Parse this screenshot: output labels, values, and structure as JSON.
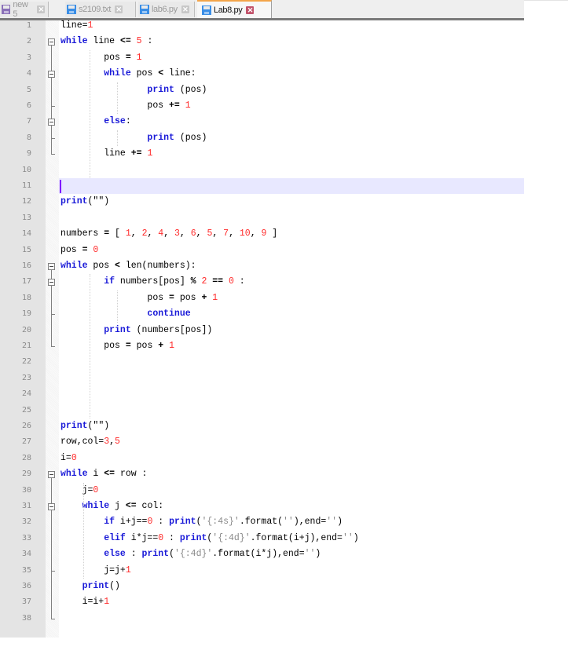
{
  "tabs": [
    {
      "label": "new 5",
      "icon": "floppy-disk-icon",
      "icon_color": "#8a70b8",
      "active": false
    },
    {
      "label": "s2109.txt",
      "icon": "floppy-disk-icon",
      "icon_color": "#3a8ee6",
      "active": false
    },
    {
      "label": "lab6.py",
      "icon": "floppy-disk-icon",
      "icon_color": "#3a8ee6",
      "active": false
    },
    {
      "label": "Lab8.py",
      "icon": "floppy-disk-icon",
      "icon_color": "#3a8ee6",
      "active": true
    }
  ],
  "close_glyph": "✕",
  "colors": {
    "keyword": "#1a1ad8",
    "number": "#ff2a2a",
    "string": "#8a8a8a",
    "caret_line": "#e8e8ff",
    "active_tab_accent": "#f3a54a"
  },
  "editor": {
    "current_line": 11,
    "lines": [
      {
        "n": "1",
        "tokens": [
          [
            "t",
            "line="
          ],
          [
            "n",
            "1"
          ]
        ]
      },
      {
        "n": "2",
        "tokens": [
          [
            "k",
            "while"
          ],
          [
            "t",
            " line "
          ],
          [
            "o",
            "<="
          ],
          [
            "t",
            " "
          ],
          [
            "n",
            "5"
          ],
          [
            "t",
            " :"
          ]
        ]
      },
      {
        "n": "3",
        "tokens": [
          [
            "t",
            "        pos "
          ],
          [
            "o",
            "="
          ],
          [
            "t",
            " "
          ],
          [
            "n",
            "1"
          ]
        ]
      },
      {
        "n": "4",
        "tokens": [
          [
            "t",
            "        "
          ],
          [
            "k",
            "while"
          ],
          [
            "t",
            " pos "
          ],
          [
            "o",
            "<"
          ],
          [
            "t",
            " line:"
          ]
        ]
      },
      {
        "n": "5",
        "tokens": [
          [
            "t",
            "                "
          ],
          [
            "k",
            "print"
          ],
          [
            "t",
            " (pos)"
          ]
        ]
      },
      {
        "n": "6",
        "tokens": [
          [
            "t",
            "                pos "
          ],
          [
            "o",
            "+="
          ],
          [
            "t",
            " "
          ],
          [
            "n",
            "1"
          ]
        ]
      },
      {
        "n": "7",
        "tokens": [
          [
            "t",
            "        "
          ],
          [
            "k",
            "else"
          ],
          [
            "t",
            ":"
          ]
        ]
      },
      {
        "n": "8",
        "tokens": [
          [
            "t",
            "                "
          ],
          [
            "k",
            "print"
          ],
          [
            "t",
            " (pos)"
          ]
        ]
      },
      {
        "n": "9",
        "tokens": [
          [
            "t",
            "        line "
          ],
          [
            "o",
            "+="
          ],
          [
            "t",
            " "
          ],
          [
            "n",
            "1"
          ]
        ]
      },
      {
        "n": "10",
        "tokens": []
      },
      {
        "n": "11",
        "tokens": []
      },
      {
        "n": "12",
        "tokens": [
          [
            "k",
            "print"
          ],
          [
            "t",
            "(\"\")"
          ]
        ]
      },
      {
        "n": "13",
        "tokens": []
      },
      {
        "n": "14",
        "tokens": [
          [
            "t",
            "numbers "
          ],
          [
            "o",
            "="
          ],
          [
            "t",
            " [ "
          ],
          [
            "n",
            "1"
          ],
          [
            "t",
            ", "
          ],
          [
            "n",
            "2"
          ],
          [
            "t",
            ", "
          ],
          [
            "n",
            "4"
          ],
          [
            "t",
            ", "
          ],
          [
            "n",
            "3"
          ],
          [
            "t",
            ", "
          ],
          [
            "n",
            "6"
          ],
          [
            "t",
            ", "
          ],
          [
            "n",
            "5"
          ],
          [
            "t",
            ", "
          ],
          [
            "n",
            "7"
          ],
          [
            "t",
            ", "
          ],
          [
            "n",
            "10"
          ],
          [
            "t",
            ", "
          ],
          [
            "n",
            "9"
          ],
          [
            "t",
            " ]"
          ]
        ]
      },
      {
        "n": "15",
        "tokens": [
          [
            "t",
            "pos "
          ],
          [
            "o",
            "="
          ],
          [
            "t",
            " "
          ],
          [
            "n",
            "0"
          ]
        ]
      },
      {
        "n": "16",
        "tokens": [
          [
            "k",
            "while"
          ],
          [
            "t",
            " pos "
          ],
          [
            "o",
            "<"
          ],
          [
            "t",
            " len(numbers):"
          ]
        ]
      },
      {
        "n": "17",
        "tokens": [
          [
            "t",
            "        "
          ],
          [
            "k",
            "if"
          ],
          [
            "t",
            " numbers[pos] "
          ],
          [
            "o",
            "%"
          ],
          [
            "t",
            " "
          ],
          [
            "n",
            "2"
          ],
          [
            "t",
            " "
          ],
          [
            "o",
            "=="
          ],
          [
            "t",
            " "
          ],
          [
            "n",
            "0"
          ],
          [
            "t",
            " :"
          ]
        ]
      },
      {
        "n": "18",
        "tokens": [
          [
            "t",
            "                pos "
          ],
          [
            "o",
            "="
          ],
          [
            "t",
            " pos "
          ],
          [
            "o",
            "+"
          ],
          [
            "t",
            " "
          ],
          [
            "n",
            "1"
          ]
        ]
      },
      {
        "n": "19",
        "tokens": [
          [
            "t",
            "                "
          ],
          [
            "k",
            "continue"
          ]
        ]
      },
      {
        "n": "20",
        "tokens": [
          [
            "t",
            "        "
          ],
          [
            "k",
            "print"
          ],
          [
            "t",
            " (numbers[pos])"
          ]
        ]
      },
      {
        "n": "21",
        "tokens": [
          [
            "t",
            "        pos "
          ],
          [
            "o",
            "="
          ],
          [
            "t",
            " pos "
          ],
          [
            "o",
            "+"
          ],
          [
            "t",
            " "
          ],
          [
            "n",
            "1"
          ]
        ]
      },
      {
        "n": "22",
        "tokens": []
      },
      {
        "n": "23",
        "tokens": []
      },
      {
        "n": "24",
        "tokens": []
      },
      {
        "n": "25",
        "tokens": []
      },
      {
        "n": "26",
        "tokens": [
          [
            "k",
            "print"
          ],
          [
            "t",
            "(\"\")"
          ]
        ]
      },
      {
        "n": "27",
        "tokens": [
          [
            "t",
            "row,col="
          ],
          [
            "n",
            "3"
          ],
          [
            "t",
            ","
          ],
          [
            "n",
            "5"
          ]
        ]
      },
      {
        "n": "28",
        "tokens": [
          [
            "t",
            "i="
          ],
          [
            "n",
            "0"
          ]
        ]
      },
      {
        "n": "29",
        "tokens": [
          [
            "k",
            "while"
          ],
          [
            "t",
            " i "
          ],
          [
            "o",
            "<="
          ],
          [
            "t",
            " row :"
          ]
        ]
      },
      {
        "n": "30",
        "tokens": [
          [
            "t",
            "    j="
          ],
          [
            "n",
            "0"
          ]
        ]
      },
      {
        "n": "31",
        "tokens": [
          [
            "t",
            "    "
          ],
          [
            "k",
            "while"
          ],
          [
            "t",
            " j "
          ],
          [
            "o",
            "<="
          ],
          [
            "t",
            " col:"
          ]
        ]
      },
      {
        "n": "32",
        "tokens": [
          [
            "t",
            "        "
          ],
          [
            "k",
            "if"
          ],
          [
            "t",
            " i+j=="
          ],
          [
            "n",
            "0"
          ],
          [
            "t",
            " : "
          ],
          [
            "k",
            "print"
          ],
          [
            "t",
            "("
          ],
          [
            "s",
            "'{:4s}'"
          ],
          [
            "t",
            ".format("
          ],
          [
            "s",
            "''"
          ],
          [
            "t",
            "),end="
          ],
          [
            "s",
            "''"
          ],
          [
            "t",
            ")"
          ]
        ]
      },
      {
        "n": "33",
        "tokens": [
          [
            "t",
            "        "
          ],
          [
            "k",
            "elif"
          ],
          [
            "t",
            " i*j=="
          ],
          [
            "n",
            "0"
          ],
          [
            "t",
            " : "
          ],
          [
            "k",
            "print"
          ],
          [
            "t",
            "("
          ],
          [
            "s",
            "'{:4d}'"
          ],
          [
            "t",
            ".format(i+j),end="
          ],
          [
            "s",
            "''"
          ],
          [
            "t",
            ")"
          ]
        ]
      },
      {
        "n": "34",
        "tokens": [
          [
            "t",
            "        "
          ],
          [
            "k",
            "else"
          ],
          [
            "t",
            " : "
          ],
          [
            "k",
            "print"
          ],
          [
            "t",
            "("
          ],
          [
            "s",
            "'{:4d}'"
          ],
          [
            "t",
            ".format(i*j),end="
          ],
          [
            "s",
            "''"
          ],
          [
            "t",
            ")"
          ]
        ]
      },
      {
        "n": "35",
        "tokens": [
          [
            "t",
            "        j=j+"
          ],
          [
            "n",
            "1"
          ]
        ]
      },
      {
        "n": "36",
        "tokens": [
          [
            "t",
            "    "
          ],
          [
            "k",
            "print"
          ],
          [
            "t",
            "()"
          ]
        ]
      },
      {
        "n": "37",
        "tokens": [
          [
            "t",
            "    i=i+"
          ],
          [
            "n",
            "1"
          ]
        ]
      },
      {
        "n": "38",
        "tokens": []
      }
    ]
  }
}
